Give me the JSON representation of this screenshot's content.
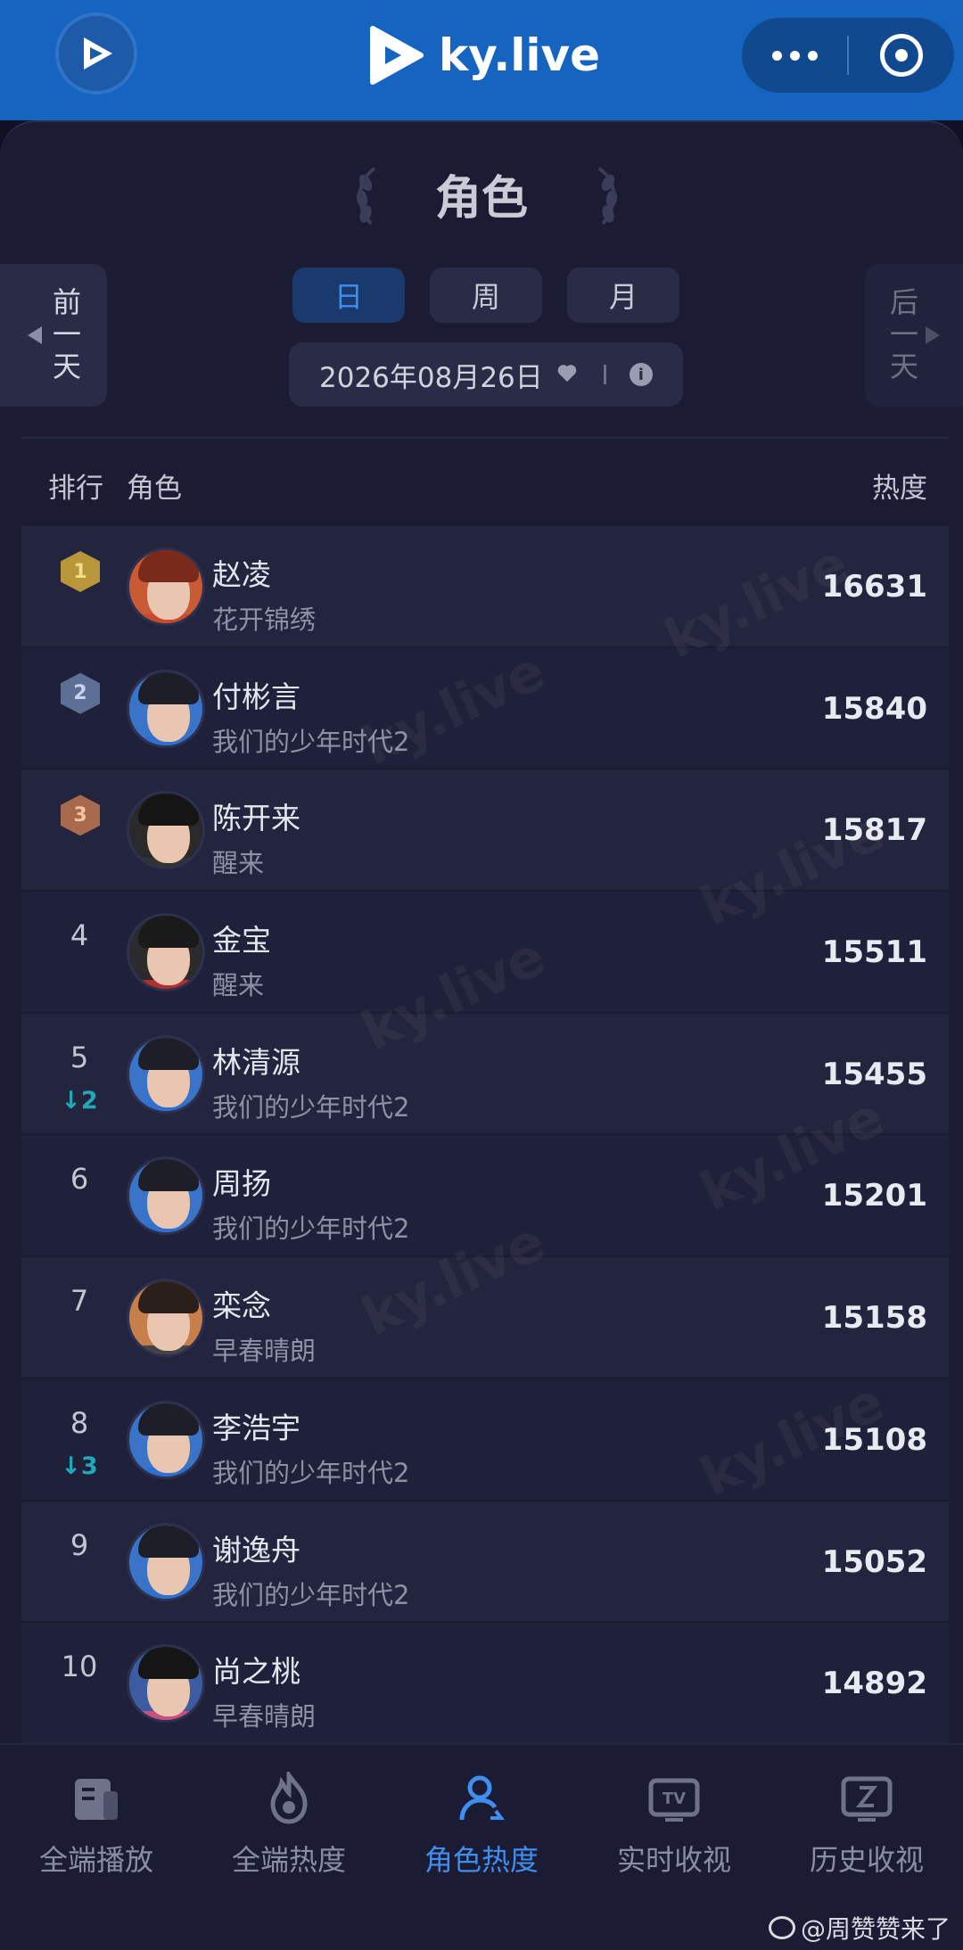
{
  "header": {
    "brand": "ky.live",
    "colors": {
      "bar": "#1565c0",
      "accent": "#3f8ff0"
    }
  },
  "page": {
    "title": "角色",
    "prev_day": "前一天",
    "next_day": "后一天",
    "period_tabs": [
      "日",
      "周",
      "月"
    ],
    "active_period": "日",
    "date": "2026年08月26日"
  },
  "table": {
    "headers": {
      "rank": "排行",
      "role": "角色",
      "heat": "热度"
    },
    "rows": [
      {
        "rank": "1",
        "change": "",
        "name": "赵凌",
        "drama": "花开锦绣",
        "heat": "16631",
        "medal": "gold"
      },
      {
        "rank": "2",
        "change": "",
        "name": "付彬言",
        "drama": "我们的少年时代2",
        "heat": "15840",
        "medal": "silver"
      },
      {
        "rank": "3",
        "change": "",
        "name": "陈开来",
        "drama": "醒来",
        "heat": "15817",
        "medal": "bronze"
      },
      {
        "rank": "4",
        "change": "",
        "name": "金宝",
        "drama": "醒来",
        "heat": "15511",
        "medal": ""
      },
      {
        "rank": "5",
        "change": "2",
        "name": "林清源",
        "drama": "我们的少年时代2",
        "heat": "15455",
        "medal": ""
      },
      {
        "rank": "6",
        "change": "",
        "name": "周扬",
        "drama": "我们的少年时代2",
        "heat": "15201",
        "medal": ""
      },
      {
        "rank": "7",
        "change": "",
        "name": "栾念",
        "drama": "早春晴朗",
        "heat": "15158",
        "medal": ""
      },
      {
        "rank": "8",
        "change": "3",
        "name": "李浩宇",
        "drama": "我们的少年时代2",
        "heat": "15108",
        "medal": ""
      },
      {
        "rank": "9",
        "change": "",
        "name": "谢逸舟",
        "drama": "我们的少年时代2",
        "heat": "15052",
        "medal": ""
      },
      {
        "rank": "10",
        "change": "",
        "name": "尚之桃",
        "drama": "早春晴朗",
        "heat": "14892",
        "medal": ""
      }
    ]
  },
  "tabbar": {
    "items": [
      {
        "label": "全端播放",
        "icon": "play-list-icon"
      },
      {
        "label": "全端热度",
        "icon": "flame-icon"
      },
      {
        "label": "角色热度",
        "icon": "person-icon"
      },
      {
        "label": "实时收视",
        "icon": "tv-icon"
      },
      {
        "label": "历史收视",
        "icon": "history-icon"
      }
    ],
    "active": "角色热度"
  },
  "watermark": "@周赞赞来了"
}
